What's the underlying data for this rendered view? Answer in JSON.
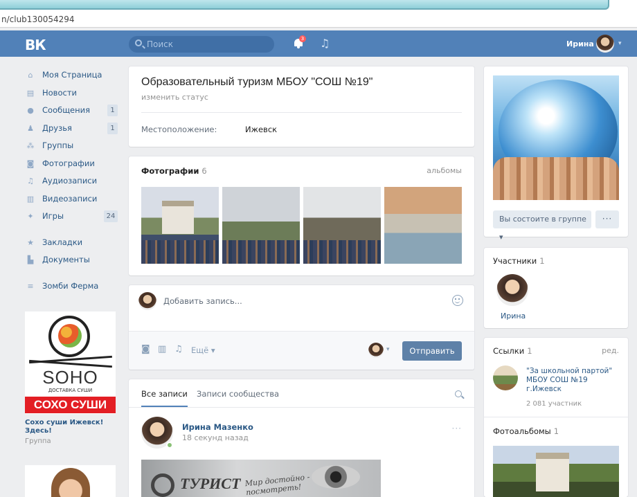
{
  "browser": {
    "url": "n/club130054294"
  },
  "header": {
    "logo": "ВК",
    "search_placeholder": "Поиск",
    "notifications_count": "3",
    "user_name": "Ирина"
  },
  "sidebar": {
    "items": [
      {
        "label": "Моя Страница",
        "icon": "home-icon",
        "count": ""
      },
      {
        "label": "Новости",
        "icon": "news-icon",
        "count": ""
      },
      {
        "label": "Сообщения",
        "icon": "messages-icon",
        "count": "1"
      },
      {
        "label": "Друзья",
        "icon": "friends-icon",
        "count": "1"
      },
      {
        "label": "Группы",
        "icon": "groups-icon",
        "count": ""
      },
      {
        "label": "Фотографии",
        "icon": "camera-icon",
        "count": ""
      },
      {
        "label": "Аудиозаписи",
        "icon": "music-icon",
        "count": ""
      },
      {
        "label": "Видеозаписи",
        "icon": "video-icon",
        "count": ""
      },
      {
        "label": "Игры",
        "icon": "games-icon",
        "count": "24"
      }
    ],
    "items2": [
      {
        "label": "Закладки",
        "icon": "star-icon"
      },
      {
        "label": "Документы",
        "icon": "document-icon"
      }
    ],
    "items3": [
      {
        "label": "Зомби Ферма",
        "icon": "app-icon"
      }
    ],
    "ad": {
      "brand": "SOHO",
      "subtitle": "ДОСТАВКА СУШИ",
      "banner": "СОХО СУШИ",
      "caption": "Сохо суши Ижевск! Здесь!",
      "type": "Группа"
    }
  },
  "group": {
    "title": "Образовательный туризм МБОУ \"СОШ №19\"",
    "status_link": "изменить статус",
    "location_label": "Местоположение:",
    "location_value": "Ижевск"
  },
  "photos": {
    "title": "Фотографии",
    "count": "6",
    "albums_link": "альбомы"
  },
  "composer": {
    "placeholder": "Добавить запись...",
    "more_label": "Ещё",
    "send_label": "Отправить"
  },
  "wall": {
    "tab_all": "Все записи",
    "tab_community": "Записи сообщества",
    "post": {
      "author": "Ирина Мазенко",
      "time": "18 секунд назад",
      "image_brand": "ТУРИСТ",
      "image_text": "Мир достойно - стоит посмотреть!"
    }
  },
  "right": {
    "member_button": "Вы состоите в группе",
    "members": {
      "title": "Участники",
      "count": "1",
      "name": "Ирина"
    },
    "links": {
      "title": "Ссылки",
      "count": "1",
      "edit": "ред.",
      "item_title": "\"За школьной партой\" МБОУ СОШ №19 г.Ижевск",
      "item_sub": "2 081 участник"
    },
    "albums": {
      "title": "Фотоальбомы",
      "count": "1"
    }
  },
  "colors": {
    "header": "#5181b8",
    "link": "#2a5885",
    "background": "#edeef0",
    "send_button": "#5e81a8"
  }
}
